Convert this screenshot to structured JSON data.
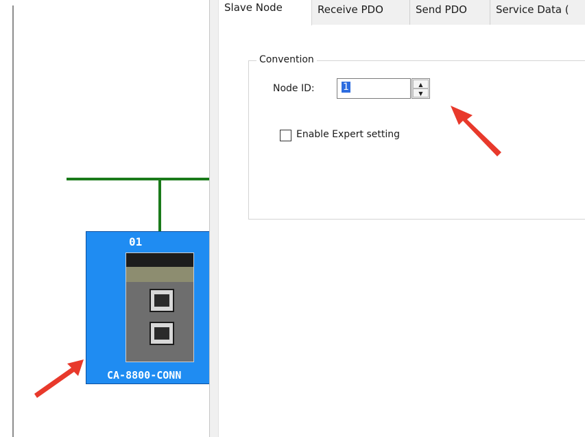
{
  "canvas": {
    "node_number": "01",
    "device_label": "CA-8800-CONN"
  },
  "tabs": [
    {
      "label": "Slave Node",
      "active": true
    },
    {
      "label": "Receive PDO"
    },
    {
      "label": "Send PDO"
    },
    {
      "label": "Service Data ("
    }
  ],
  "convention": {
    "legend": "Convention",
    "node_id_label": "Node ID:",
    "node_id_value": "1",
    "expert_label": "Enable Expert setting",
    "expert_checked": false
  },
  "icons": {
    "spin_up": "spin-up-arrow",
    "spin_down": "spin-down-arrow",
    "annotation": "red-arrow"
  },
  "colors": {
    "bus": "#1a7a1a",
    "device": "#1f8cf2",
    "annotation": "#e8392b",
    "selection": "#2d6cdf"
  }
}
